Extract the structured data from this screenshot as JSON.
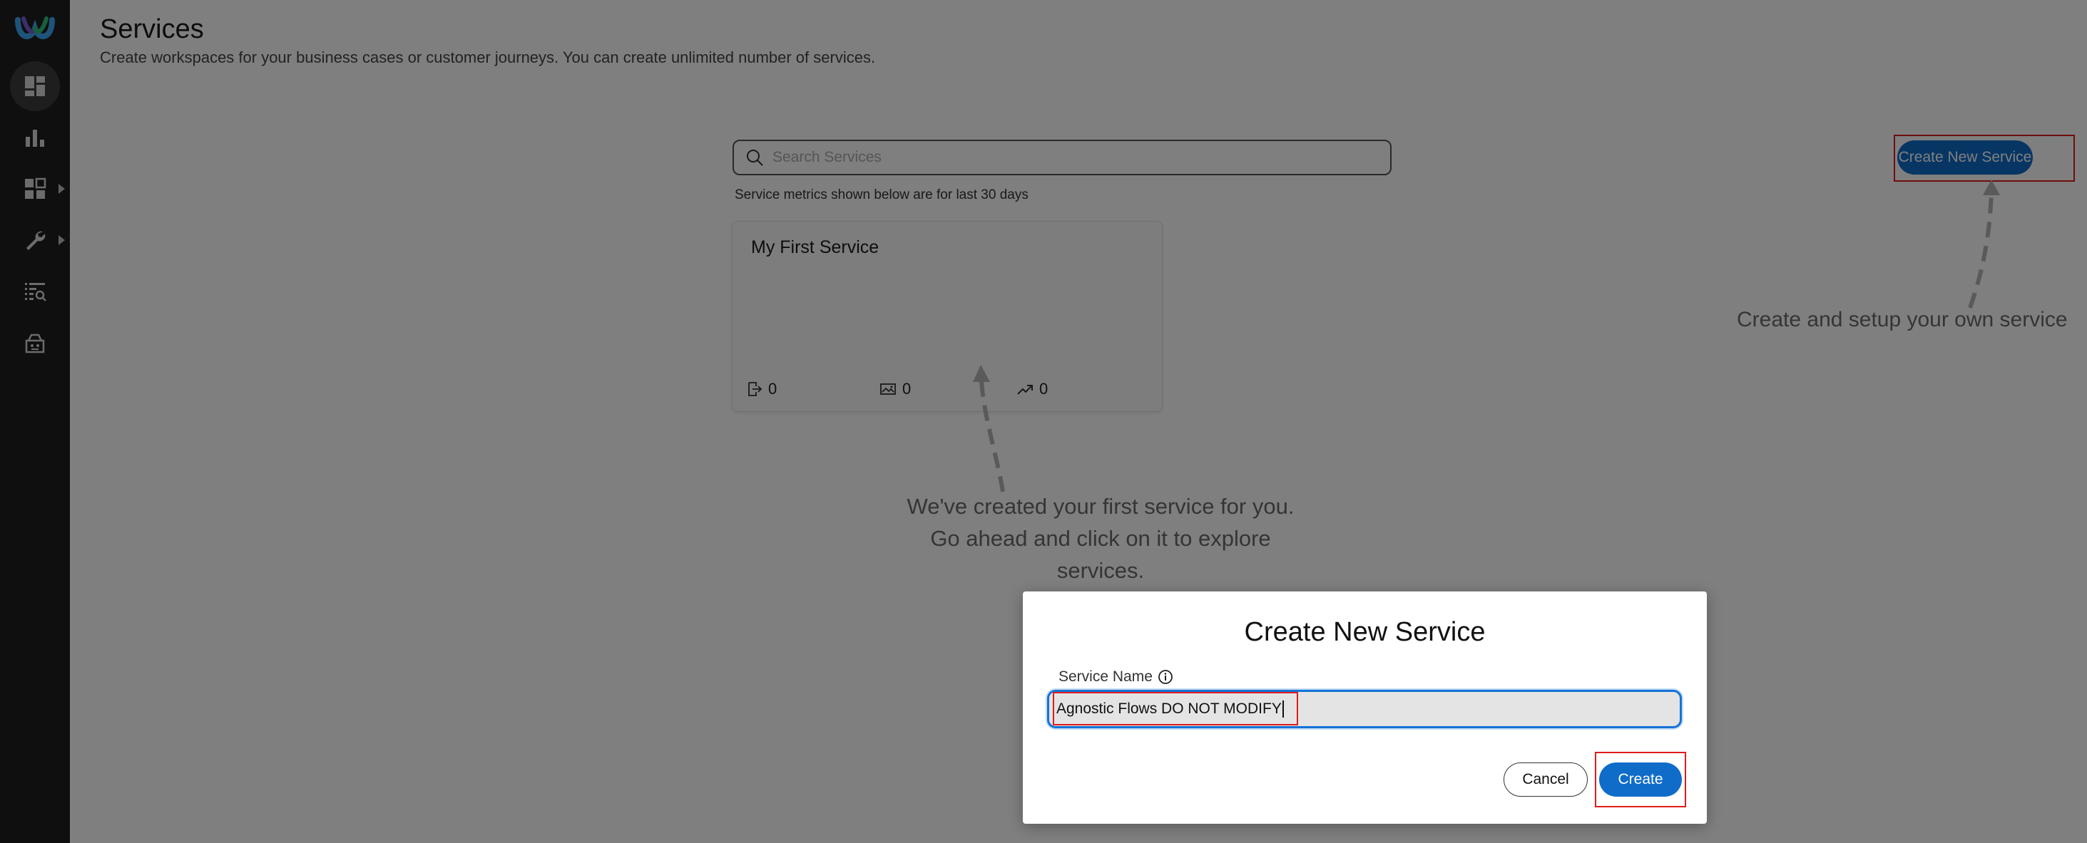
{
  "sidebar": {
    "logo": "webex-logo",
    "items": [
      {
        "icon": "dashboard-icon",
        "active": true
      },
      {
        "icon": "analytics-icon",
        "active": false
      },
      {
        "icon": "apps-icon",
        "active": false,
        "expandable": true
      },
      {
        "icon": "wrench-icon",
        "active": false,
        "expandable": true
      },
      {
        "icon": "list-search-icon",
        "active": false
      },
      {
        "icon": "robot-icon",
        "active": false
      }
    ]
  },
  "page": {
    "title": "Services",
    "subtitle": "Create workspaces for your business cases or customer journeys. You can create unlimited number of services."
  },
  "search": {
    "placeholder": "Search Services"
  },
  "metrics_note": "Service metrics shown below are for last 30 days",
  "service_card": {
    "title": "My First Service",
    "metrics": [
      {
        "icon": "entry-icon",
        "value": "0"
      },
      {
        "icon": "image-chart-icon",
        "value": "0"
      },
      {
        "icon": "trend-up-icon",
        "value": "0"
      }
    ]
  },
  "create_button_label": "Create New Service",
  "hints": {
    "right": "Create and setup your own service",
    "center": [
      "We've created your first service for you.",
      "Go ahead and click on it to explore",
      "services."
    ]
  },
  "modal": {
    "title": "Create New Service",
    "field_label": "Service Name",
    "field_value": "Agnostic Flows DO NOT MODIFY",
    "cancel_label": "Cancel",
    "create_label": "Create"
  },
  "colors": {
    "sidebar_bg": "#1f1f1f",
    "accent": "#0f6cc9",
    "highlight_outline": "#e21b1b",
    "overlay": "rgba(0,0,0,0.5)"
  }
}
